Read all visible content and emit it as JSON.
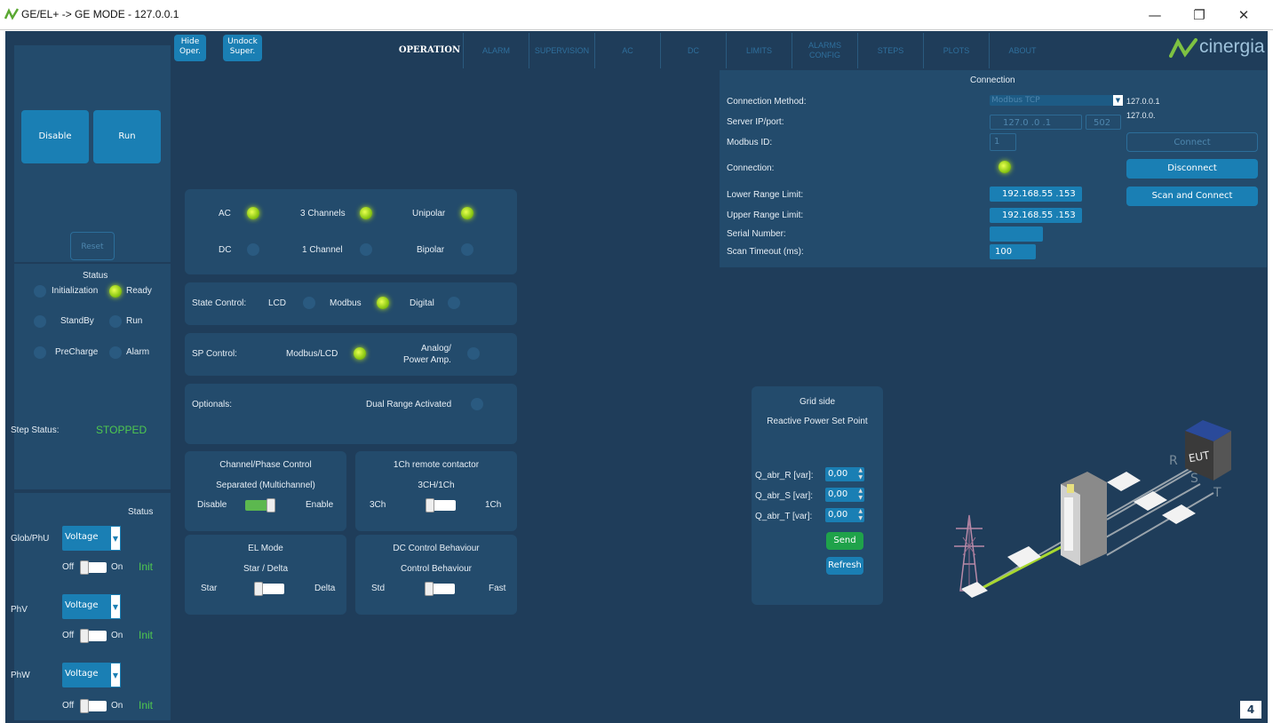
{
  "window": {
    "title": "GE/EL+ -> GE MODE - 127.0.0.1"
  },
  "top_buttons": {
    "hide": "Hide Oper.",
    "undock": "Undock Super."
  },
  "tabs": [
    "OPERATION",
    "ALARM",
    "SUPERVISION",
    "AC",
    "DC",
    "LIMITS",
    "ALARMS CONFIG",
    "STEPS",
    "PLOTS",
    "ABOUT"
  ],
  "brand": "cinergia",
  "left": {
    "disable": "Disable",
    "run": "Run",
    "reset": "Reset",
    "status_title": "Status",
    "status": [
      {
        "label": "Initialization",
        "on": false
      },
      {
        "label": "Ready",
        "on": true
      },
      {
        "label": "StandBy",
        "on": false
      },
      {
        "label": "Run",
        "on": false
      },
      {
        "label": "PreCharge",
        "on": false
      },
      {
        "label": "Alarm",
        "on": false
      }
    ],
    "step_status_label": "Step Status:",
    "step_status_value": "STOPPED",
    "status_hdr": "Status",
    "rows": [
      {
        "label": "Glob/PhU",
        "select": "Voltage",
        "off": "Off",
        "on": "On",
        "status": "Init"
      },
      {
        "label": "PhV",
        "select": "Voltage",
        "off": "Off",
        "on": "On",
        "status": "Init"
      },
      {
        "label": "PhW",
        "select": "Voltage",
        "off": "Off",
        "on": "On",
        "status": "Init"
      }
    ]
  },
  "config": {
    "ac": "AC",
    "dc": "DC",
    "ch3": "3 Channels",
    "ch1": "1 Channel",
    "unipolar": "Unipolar",
    "bipolar": "Bipolar",
    "state_control": "State Control:",
    "lcd": "LCD",
    "modbus": "Modbus",
    "digital": "Digital",
    "sp_control": "SP Control:",
    "modbus_lcd": "Modbus/LCD",
    "analog": "Analog/",
    "power_amp": "Power Amp.",
    "optionals": "Optionals:",
    "dual_range": "Dual Range Activated",
    "chphase": {
      "title": "Channel/Phase Control",
      "sub": "Separated (Multichannel)",
      "left": "Disable",
      "right": "Enable"
    },
    "remote": {
      "title": "1Ch remote contactor",
      "sub": "3CH/1Ch",
      "left": "3Ch",
      "right": "1Ch"
    },
    "elmode": {
      "title": "EL Mode",
      "sub": "Star / Delta",
      "left": "Star",
      "right": "Delta"
    },
    "dcbeh": {
      "title": "DC Control Behaviour",
      "sub": "Control Behaviour",
      "left": "Std",
      "right": "Fast"
    }
  },
  "connection": {
    "title": "Connection",
    "method_label": "Connection Method:",
    "method_value": "Modbus TCP",
    "ip_label": "Server IP/port:",
    "ip_value": "127.0 .0 .1",
    "port_value": "502",
    "id_label": "Modbus ID:",
    "id_value": "1",
    "conn_label": "Connection:",
    "lower_label": "Lower Range Limit:",
    "lower_value": "192.168.55 .153",
    "upper_label": "Upper Range Limit:",
    "upper_value": "192.168.55 .153",
    "serial_label": "Serial Number:",
    "serial_value": "",
    "timeout_label": "Scan Timeout (ms):",
    "timeout_value": "100",
    "ip_display1": "127.0.0.1",
    "ip_display2": "127.0.0.",
    "connect": "Connect",
    "disconnect": "Disconnect",
    "scan": "Scan and Connect"
  },
  "grid": {
    "title": "Grid side",
    "subtitle": "Reactive Power Set Point",
    "rows": [
      {
        "label": "Q_abr_R [var]:",
        "value": "0,00"
      },
      {
        "label": "Q_abr_S [var]:",
        "value": "0,00"
      },
      {
        "label": "Q_abr_T [var]:",
        "value": "0,00"
      }
    ],
    "send": "Send",
    "refresh": "Refresh"
  },
  "diagram": {
    "r": "R",
    "s": "S",
    "t": "T",
    "eut": "EUT"
  },
  "page_badge": "4"
}
